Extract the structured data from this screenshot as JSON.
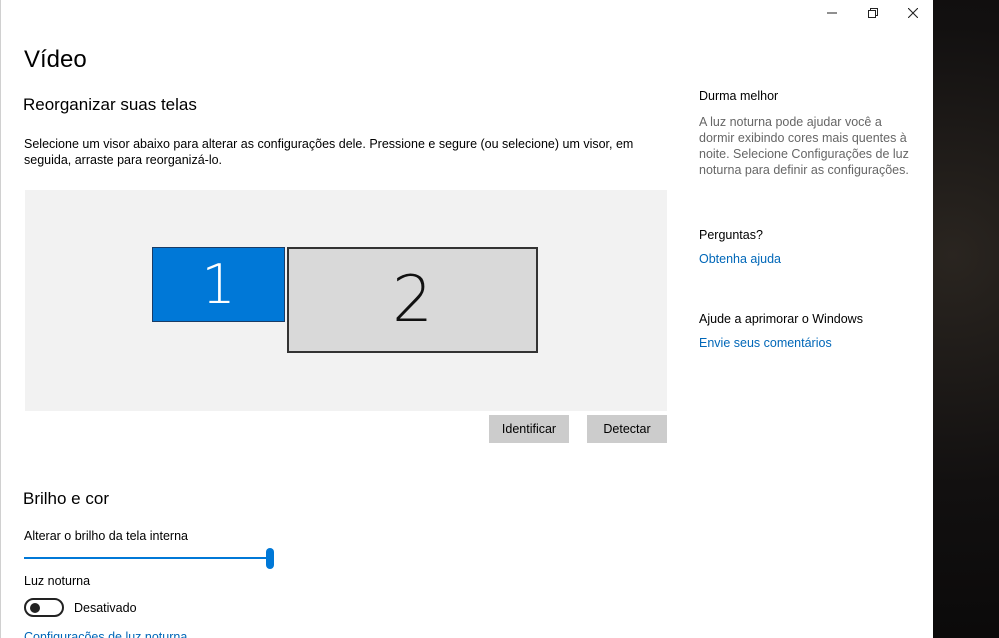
{
  "window": {
    "caption_min": "—",
    "caption_restore": "❐",
    "caption_close": "✕"
  },
  "page": {
    "title": "Vídeo"
  },
  "arrange": {
    "title": "Reorganizar suas telas",
    "description": "Selecione um visor abaixo para alterar as configurações dele. Pressione e segure (ou selecione) um visor, em seguida, arraste para reorganizá-lo.",
    "monitors": [
      {
        "label": "1",
        "selected": true
      },
      {
        "label": "2",
        "selected": false
      }
    ],
    "identify_label": "Identificar",
    "detect_label": "Detectar"
  },
  "brightness": {
    "title": "Brilho e cor",
    "slider_label": "Alterar o brilho da tela interna",
    "slider_value_percent": 100,
    "night_light_label": "Luz noturna",
    "night_light_state": "Desativado",
    "partial_link": "Configurações de luz noturna"
  },
  "sidebar": {
    "sleep_title": "Durma melhor",
    "sleep_text": "A luz noturna pode ajudar você a dormir exibindo cores mais quentes à noite. Selecione Configurações de luz noturna para definir as configurações.",
    "questions_title": "Perguntas?",
    "help_link": "Obtenha ajuda",
    "improve_title": "Ajude a aprimorar o Windows",
    "feedback_link": "Envie seus comentários"
  },
  "colors": {
    "accent": "#0078d7",
    "link": "#0067b8",
    "button_bg": "#cccccc",
    "display_area_bg": "#f2f2f2"
  }
}
